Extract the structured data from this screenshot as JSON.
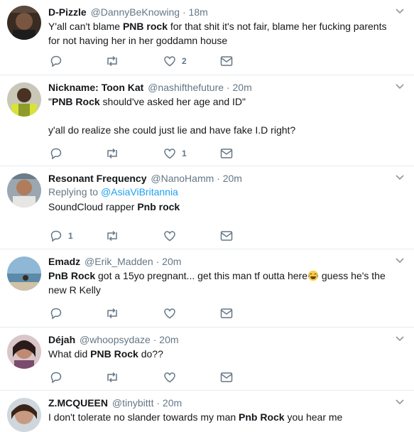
{
  "tweets": [
    {
      "name": "D-Pizzle",
      "handle": "@DannyBeKnowing",
      "time": "18m",
      "text_parts": [
        "Y'all can't blame ",
        "PNB rock",
        " for that shit it's not fair, blame her fucking parents for not having her in her goddamn house"
      ],
      "reply_count": "",
      "like_count": "2"
    },
    {
      "name": "Nickname: Toon Kat",
      "handle": "@nashifthefuture",
      "time": "20m",
      "line1_parts": [
        "\"",
        "PNB Rock",
        " should've asked her age and ID\""
      ],
      "line2": "y'all do realize she could just lie and have fake I.D right?",
      "reply_count": "",
      "like_count": "1"
    },
    {
      "name": "Resonant Frequency",
      "handle": "@NanoHamm",
      "time": "20m",
      "replying_prefix": "Replying to ",
      "replying_to": "@AsiaViBritannia",
      "text_parts": [
        "SoundCloud rapper ",
        "Pnb rock"
      ],
      "reply_count": "1",
      "like_count": ""
    },
    {
      "name": "Emadz",
      "handle": "@Erik_Madden",
      "time": "20m",
      "text_parts": [
        "PnB Rock",
        " got a 15yo pregnant... get this man tf outta here",
        " guess he's the new R Kelly"
      ],
      "emoji": "face-with-tears-of-joy",
      "reply_count": "",
      "like_count": ""
    },
    {
      "name": "Déjah",
      "handle": "@whoopsydaze",
      "time": "20m",
      "text_parts": [
        "What did ",
        "PNB Rock",
        " do??"
      ],
      "reply_count": "",
      "like_count": ""
    },
    {
      "name": "Z.MCQUEEN",
      "handle": "@tinybittt",
      "time": "20m",
      "text_parts": [
        "I don't tolerate no slander towards my man ",
        "Pnb Rock",
        " you hear me"
      ],
      "reply_count": "",
      "like_count": ""
    }
  ],
  "separator": "·",
  "colors": {
    "muted": "#657786",
    "link": "#1da1f2",
    "border": "#e6ecf0",
    "text": "#14171a"
  }
}
